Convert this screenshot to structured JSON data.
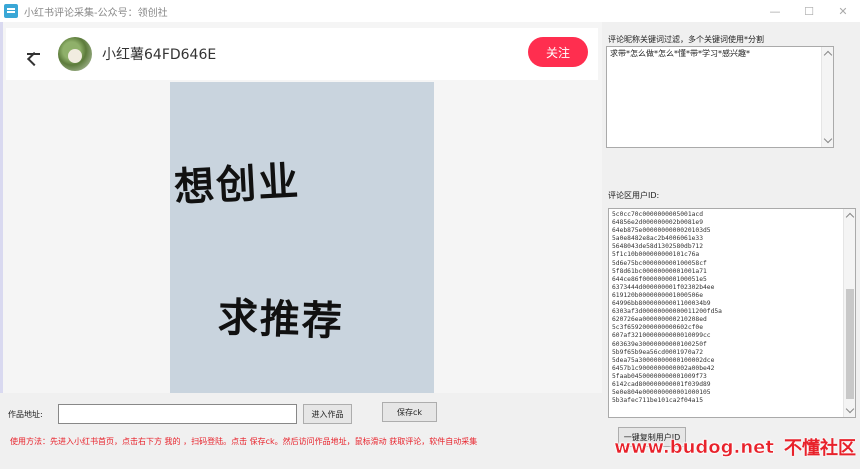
{
  "window": {
    "title": "小红书评论采集-公众号：领创社",
    "controls": {
      "minimize": "—",
      "maximize": "☐",
      "close": "✕"
    }
  },
  "post": {
    "username": "小红薯64FD646E",
    "follow_label": "关注",
    "image_text_line1": "想创业",
    "image_text_line2": "求推荐"
  },
  "form": {
    "url_label": "作品地址:",
    "url_value": "",
    "enter_button": "进入作品",
    "save_button": "保存ck"
  },
  "usage_text": "使用方法：先进入小红书首页，点击右下方 我的  ，扫码登陆。点击 保存ck。然后访问作品地址，鼠标滑动 获取评论，软件自动采集",
  "keywords": {
    "label": "评论昵称关键词过滤，多个关键词使用*分割",
    "value": "求带*怎么做*怎么*懂*带*学习*感兴趣*"
  },
  "user_ids": {
    "label": "评论区用户ID:",
    "items": [
      "5c0cc70c0000000005001acd",
      "64856e2d000000002b0081e9",
      "64eb875e0000000000020103d5",
      "5a0e8482e8ac2b4006061e33",
      "5648043de58d1302580db712",
      "5f1c10b000000000101c76a",
      "5d6e75bc000000000100058cf",
      "5f8d61bc00000000001001a71",
      "644ce86f000000000100051e5",
      "6373444d000000001f02302b4ee",
      "619120b0000000001000506e",
      "64996bb80000000001100034b9",
      "6303af3d00000000000011200fd5a",
      "620726ea000000000210208ed",
      "5c3f6592000000000602cf0e",
      "607af3210000000000010099cc",
      "603639e30000000000100250f",
      "5b9f65b9ea56cd0001970a72",
      "5dea75a30000000000100002dce",
      "6457b1c9000000000002a00be42",
      "5faab04500000000001009f73",
      "6142cad800000000001f039d89",
      "5e0e804e000000000001000105",
      "5b3afec711be101ca2f04a15"
    ]
  },
  "export_button": "一键复制用户ID",
  "watermark": {
    "url": "www.budog.net",
    "cn": "不懂社区"
  }
}
